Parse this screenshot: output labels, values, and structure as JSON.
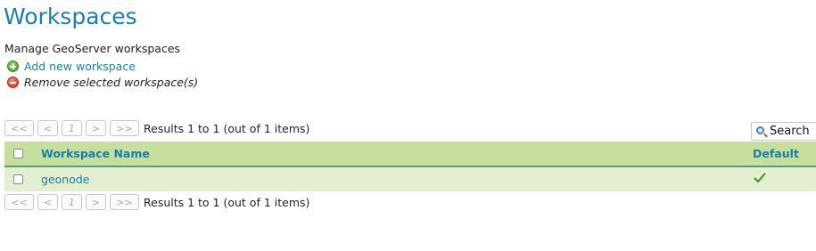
{
  "page": {
    "title": "Workspaces",
    "description": "Manage GeoServer workspaces"
  },
  "actions": {
    "add_label": "Add new workspace",
    "remove_label": "Remove selected workspace(s)"
  },
  "pager": {
    "first": "<<",
    "prev": "<",
    "current_page": "1",
    "next": ">",
    "last": ">>",
    "results_text": "Results 1 to 1 (out of 1 items)"
  },
  "search": {
    "label": "Search"
  },
  "table": {
    "columns": [
      "Workspace Name",
      "Default"
    ],
    "rows": [
      {
        "name": "geonode",
        "default": true
      }
    ]
  },
  "colors": {
    "accent": "#1b7fa6",
    "header_bg": "#c6df9f",
    "row_bg": "#e3efd0",
    "check_green": "#4a9a30"
  },
  "icons": {
    "add": "plus-circle-icon",
    "remove": "minus-circle-icon",
    "search": "magnifier-icon",
    "default": "checkmark-icon"
  }
}
